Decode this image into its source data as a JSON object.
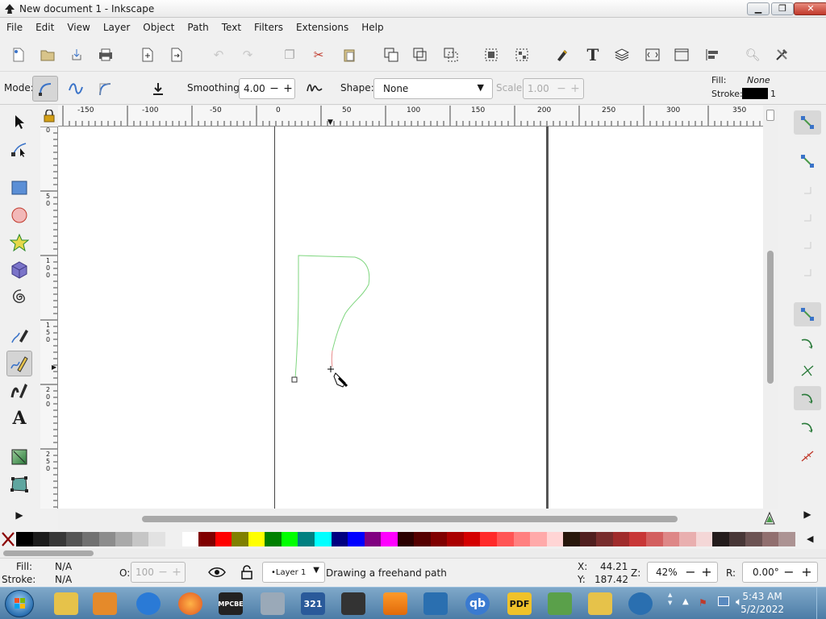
{
  "window": {
    "title": "New document 1 - Inkscape"
  },
  "menu": [
    "File",
    "Edit",
    "View",
    "Layer",
    "Object",
    "Path",
    "Text",
    "Filters",
    "Extensions",
    "Help"
  ],
  "toolctl": {
    "mode_label": "Mode:",
    "smoothing_label": "Smoothing:",
    "smoothing_value": "4.00",
    "shape_label": "Shape:",
    "shape_value": "None",
    "scale_label": "Scale:",
    "scale_value": "1.00",
    "fill_label": "Fill:",
    "fill_value": "None",
    "stroke_label": "Stroke:",
    "stroke_width": "1",
    "stroke_color": "#000000"
  },
  "ruler": {
    "h_labels": [
      "-150",
      "-100",
      "-50",
      "0",
      "50",
      "100",
      "150",
      "200",
      "250",
      "300",
      "350"
    ],
    "v_labels": [
      "0",
      "50",
      "100",
      "150",
      "200",
      "250"
    ]
  },
  "colors": {
    "path_stroke": "#7fd67f",
    "path_tail": "#e88a8a",
    "accent": "#3a73c8"
  },
  "palette": [
    "#000000",
    "#1c1c1c",
    "#383838",
    "#555555",
    "#717171",
    "#8d8d8d",
    "#aaaaaa",
    "#c6c6c6",
    "#e2e2e2",
    "#f0f0f0",
    "#ffffff",
    "#800000",
    "#ff0000",
    "#808000",
    "#ffff00",
    "#008000",
    "#00ff00",
    "#008080",
    "#00ffff",
    "#000080",
    "#0000ff",
    "#800080",
    "#ff00ff",
    "#2b0000",
    "#550000",
    "#800000",
    "#aa0000",
    "#d40000",
    "#ff2a2a",
    "#ff5555",
    "#ff8080",
    "#ffaaaa",
    "#ffd5d5",
    "#28170b",
    "#501f1f",
    "#782d2d",
    "#a02c2c",
    "#c83737",
    "#d35f5f",
    "#de8787",
    "#e9afaf",
    "#f4d7d7",
    "#241c1c",
    "#483737",
    "#6c5353",
    "#916f6f",
    "#ac9393"
  ],
  "status": {
    "fill_label": "Fill:",
    "fill_value": "N/A",
    "stroke_label": "Stroke:",
    "stroke_value": "N/A",
    "opacity_label": "O:",
    "opacity_value": "100",
    "layer": "•Layer 1",
    "message": "Drawing a freehand path",
    "x_label": "X:",
    "x_value": "44.21",
    "y_label": "Y:",
    "y_value": "187.42",
    "zoom_label": "Z:",
    "zoom_value": "42%",
    "rotate_label": "R:",
    "rotate_value": "0.00°"
  },
  "taskbar": {
    "apps": [
      "",
      "",
      "",
      "",
      "",
      "MPCBE",
      "",
      "321",
      "",
      "",
      "",
      "qb",
      "PDF",
      "",
      "",
      ""
    ],
    "time": "5:43 AM",
    "date": "5/2/2022"
  }
}
